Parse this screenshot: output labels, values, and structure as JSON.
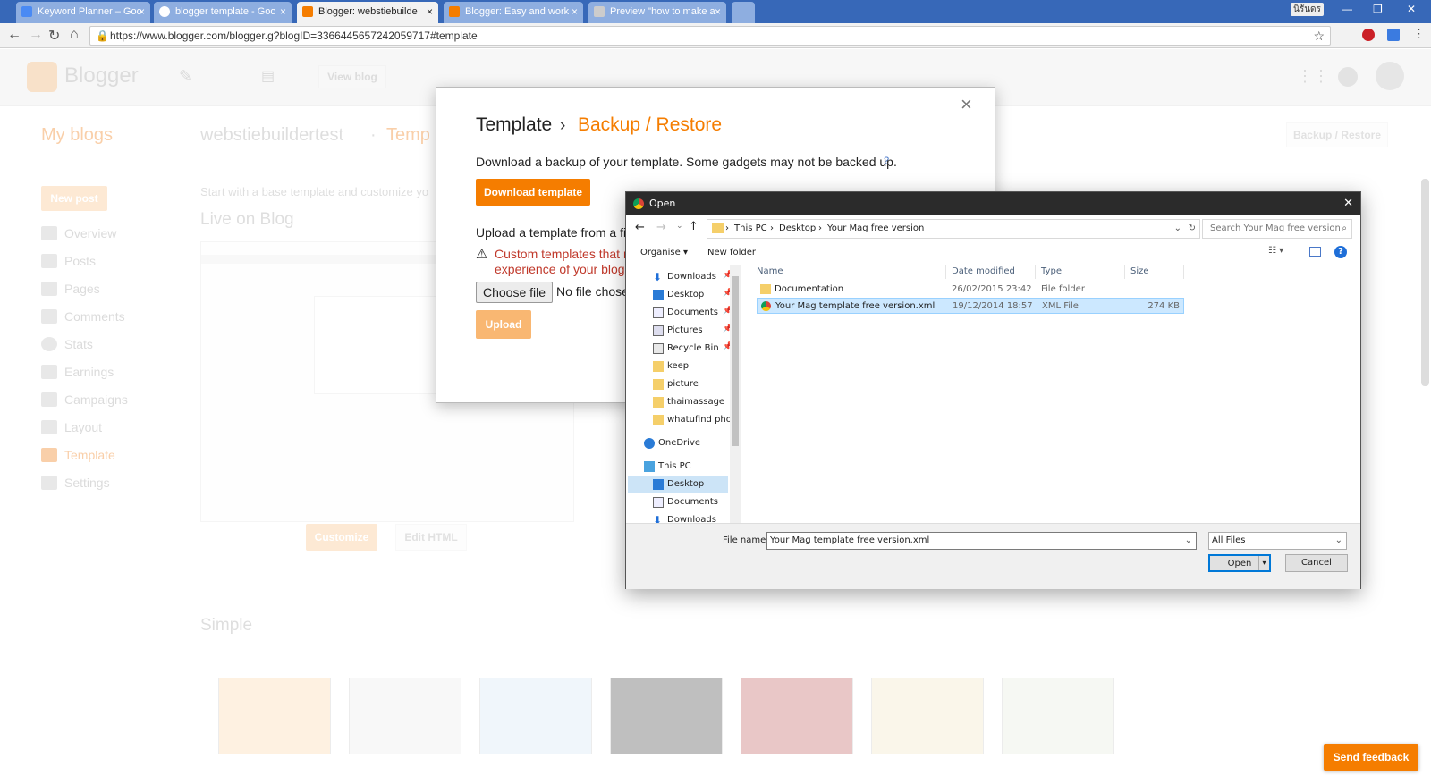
{
  "browser": {
    "tabs": [
      {
        "label": "Keyword Planner – Goo",
        "icon": "google-ads-icon",
        "color": "#4a8af4"
      },
      {
        "label": "blogger template - Goo",
        "icon": "google-icon",
        "color": "#ffffff"
      },
      {
        "label": "Blogger: webstiebuilde",
        "icon": "blogger-icon",
        "color": "#f57d00"
      },
      {
        "label": "Blogger: Easy and work",
        "icon": "blogger-icon",
        "color": "#f57d00"
      },
      {
        "label": "Preview \"how to make a",
        "icon": "page-icon",
        "color": "#cccccc"
      }
    ],
    "window_label": "นิรันดร",
    "url": "https://www.blogger.com/blogger.g?blogID=3366445657242059717#template"
  },
  "blogger": {
    "logo": "Blogger",
    "view_blog": "View blog",
    "my_blogs": "My blogs",
    "blog_name": "webstiebuildertest",
    "separator": "·",
    "section": "Temp",
    "backup_restore": "Backup / Restore",
    "new_post": "New post",
    "intro": "Start with a base template and customize yo",
    "live_on_blog": "Live on Blog",
    "sidebar": [
      "Overview",
      "Posts",
      "Pages",
      "Comments",
      "Stats",
      "Earnings",
      "Campaigns",
      "Layout",
      "Template",
      "Settings"
    ],
    "customize": "Customize",
    "edit_html": "Edit HTML",
    "simple": "Simple",
    "send_feedback": "Send feedback",
    "accent": "#f57d00"
  },
  "modal": {
    "title": "Template",
    "crumb_sep": "›",
    "subtitle": "Backup / Restore",
    "download_text": "Download a backup of your template. Some gadgets may not be backed up.",
    "help": "?",
    "download_button": "Download template",
    "upload_text": "Upload a template from a file",
    "warning_line1": "Custom templates that m",
    "warning_line2": "experience of your blog",
    "choose_file": "Choose file",
    "no_file": "No file chose",
    "upload_button": "Upload",
    "close": "×",
    "warning_color": "#c0392b"
  },
  "open_dialog": {
    "title": "Open",
    "close": "✕",
    "breadcrumb": [
      "This PC",
      "Desktop",
      "Your Mag free version"
    ],
    "search_placeholder": "Search Your Mag free version",
    "organise": "Organise ▾",
    "new_folder": "New folder",
    "nav_items": [
      {
        "label": "Downloads",
        "icon": "download-arrow-icon",
        "pinned": true
      },
      {
        "label": "Desktop",
        "icon": "desktop-icon",
        "pinned": true
      },
      {
        "label": "Documents",
        "icon": "documents-icon",
        "pinned": true
      },
      {
        "label": "Pictures",
        "icon": "pictures-icon",
        "pinned": true
      },
      {
        "label": "Recycle Bin",
        "icon": "recycle-bin-icon",
        "pinned": true
      },
      {
        "label": "keep",
        "icon": "folder-icon",
        "pinned": false
      },
      {
        "label": "picture",
        "icon": "folder-icon",
        "pinned": false
      },
      {
        "label": "thaimassage",
        "icon": "folder-icon",
        "pinned": false
      },
      {
        "label": "whatufind photo",
        "icon": "folder-icon",
        "pinned": false
      }
    ],
    "onedrive": "OneDrive",
    "this_pc": "This PC",
    "pc_items": [
      {
        "label": "Desktop",
        "icon": "desktop-icon",
        "selected": true
      },
      {
        "label": "Documents",
        "icon": "documents-icon",
        "selected": false
      },
      {
        "label": "Downloads",
        "icon": "download-arrow-icon",
        "selected": false
      }
    ],
    "columns": [
      "Name",
      "Date modified",
      "Type",
      "Size"
    ],
    "files": [
      {
        "name": "Documentation",
        "date": "26/02/2015 23:42",
        "type": "File folder",
        "size": "",
        "icon": "folder-icon",
        "selected": false
      },
      {
        "name": "Your Mag template free version.xml",
        "date": "19/12/2014 18:57",
        "type": "XML File",
        "size": "274 KB",
        "icon": "chrome-icon",
        "selected": true
      }
    ],
    "filename_label": "File name:",
    "filename_value": "Your Mag template free version.xml",
    "filetype": "All Files",
    "open_button": "Open",
    "cancel_button": "Cancel"
  }
}
